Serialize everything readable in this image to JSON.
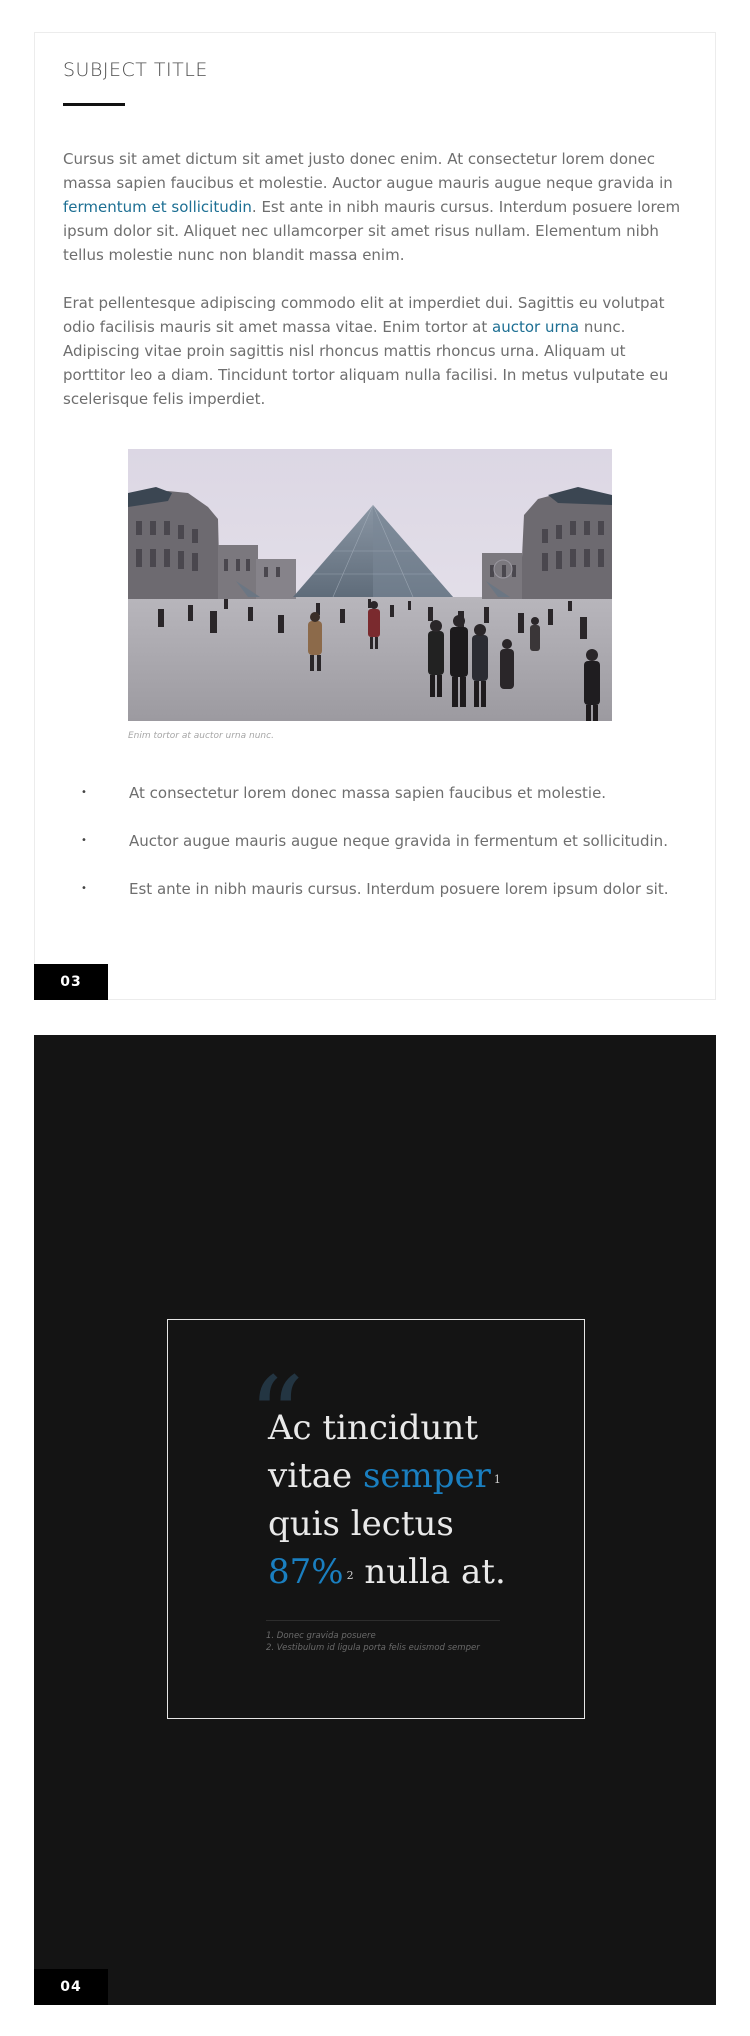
{
  "page1": {
    "subject_title": "SUBJECT TITLE",
    "para1": {
      "before_link": "Cursus sit amet dictum sit amet justo donec enim. At consectetur lorem donec massa sapien faucibus et molestie. Auctor augue mauris augue neque gravida in ",
      "link": "fermentum et sollicitudin",
      "after_link": ". Est ante in nibh mauris cursus. Interdum posuere lorem ipsum dolor sit. Aliquet nec ullamcorper sit amet risus nullam. Elementum nibh tellus molestie nunc non blandit massa enim."
    },
    "para2": {
      "before_link": "Erat pellentesque adipiscing commodo elit at imperdiet dui. Sagittis eu volutpat odio facilisis mauris sit amet massa vitae. Enim tortor at ",
      "link": "auctor urna",
      "after_link": " nunc. Adipiscing vitae proin sagittis nisl rhoncus mattis rhoncus urna. Aliquam ut porttitor leo a diam. Tincidunt tortor aliquam nulla facilisi. In metus vulputate eu scelerisque felis imperdiet."
    },
    "caption": "Enim tortor at auctor urna nunc.",
    "bullet_glyph": "•",
    "bullets": [
      "At consectetur lorem donec massa sapien faucibus et molestie.",
      "Auctor augue mauris augue neque gravida in fermentum et sollicitudin.",
      "Est ante in nibh mauris cursus. Interdum posuere lorem ipsum dolor sit."
    ],
    "page_number": "03"
  },
  "page2": {
    "quote_mark": "“",
    "quote": {
      "line1": "Ac tincidunt",
      "line2_plain": "vitae ",
      "line2_accent": "semper",
      "sup1": "1",
      "line3": "quis lectus",
      "line4_accent": "87%",
      "sup2": "2",
      "line4_plain": " nulla at."
    },
    "footnotes": [
      "1. Donec gravida posuere",
      "2. Vestibulum id ligula porta felis euismod semper"
    ],
    "page_number": "04"
  },
  "colors": {
    "accent_link": "#1d6f93",
    "accent_quote": "#1a7fc0",
    "dark_page": "#141414",
    "page_number_bg": "#000000"
  }
}
